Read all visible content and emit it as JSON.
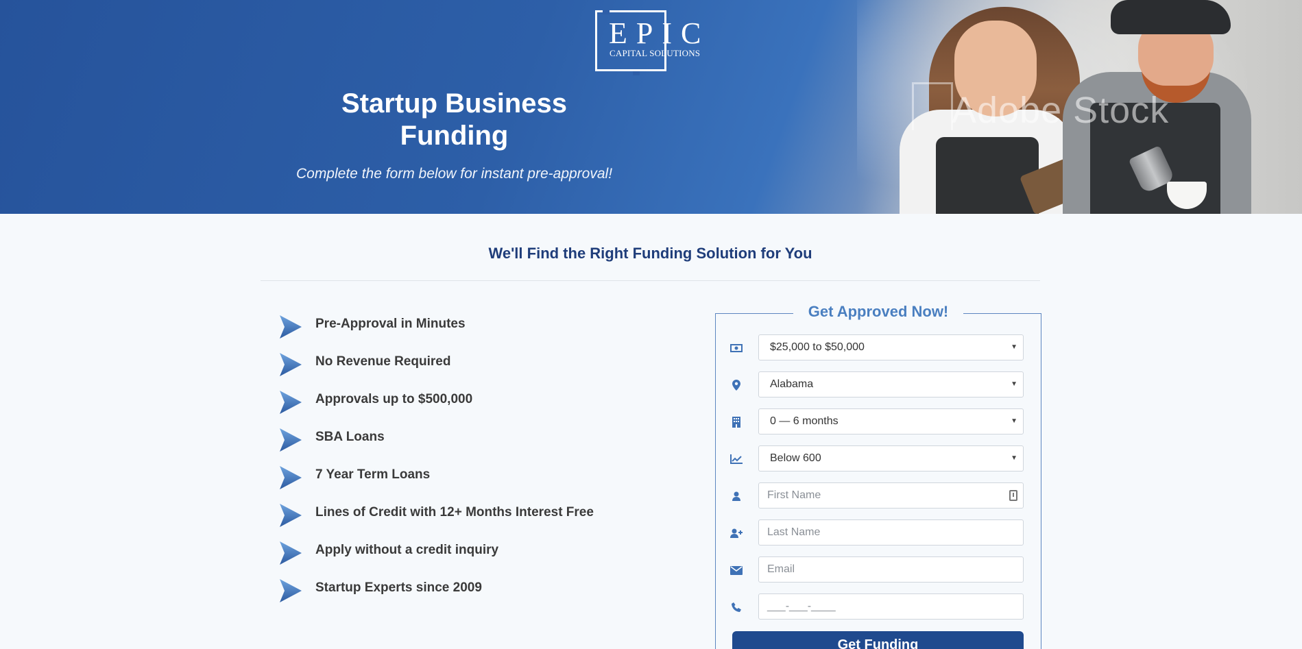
{
  "logo": {
    "word": "EPIC",
    "subtitle": "CAPITAL SOLUTIONS"
  },
  "hero": {
    "title": "Startup Business Funding",
    "subtitle": "Complete the form below for instant pre-approval!",
    "watermark": "Adobe Stock"
  },
  "section": {
    "heading": "We'll Find the Right Funding Solution for You"
  },
  "features": [
    "Pre-Approval in Minutes",
    "No Revenue Required",
    "Approvals up to $500,000",
    "SBA Loans",
    "7 Year Term Loans",
    "Lines of Credit with 12+ Months Interest Free",
    "Apply without a credit inquiry",
    "Startup Experts since 2009"
  ],
  "form": {
    "legend": "Get Approved Now!",
    "amount": "$25,000 to $50,000",
    "state": "Alabama",
    "time_in_business": "0 — 6 months",
    "credit_score": "Below 600",
    "first_name_placeholder": "First Name",
    "last_name_placeholder": "Last Name",
    "email_placeholder": "Email",
    "phone_placeholder": "___-___-____",
    "submit": "Get Funding"
  },
  "colors": {
    "brand_blue": "#2d5fa8",
    "heading_navy": "#1f3d7a",
    "accent_blue": "#4a7fc0",
    "button": "#1f4a8e"
  },
  "icons": {
    "amount": "money-icon",
    "state": "map-marker-icon",
    "time": "building-icon",
    "credit": "line-chart-icon",
    "first": "user-icon",
    "last": "user-plus-icon",
    "email": "envelope-icon",
    "phone": "phone-icon",
    "feature": "arrow-bullet-icon"
  }
}
